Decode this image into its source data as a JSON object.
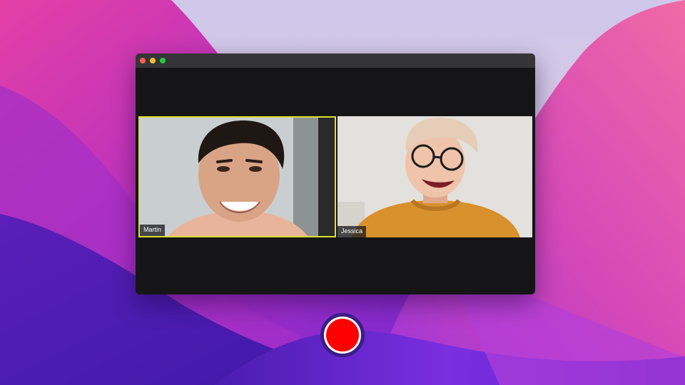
{
  "window": {
    "controls": [
      {
        "name": "close",
        "color": "#ff5f57"
      },
      {
        "name": "minimize",
        "color": "#febc2e"
      },
      {
        "name": "maximize",
        "color": "#28c840"
      }
    ]
  },
  "participants": [
    {
      "name": "Martin",
      "active_speaker": true,
      "highlight_color": "#d9e02e"
    },
    {
      "name": "Jessica",
      "active_speaker": false
    }
  ],
  "record_button": {
    "icon": "record-icon",
    "color": "#ff0000"
  }
}
